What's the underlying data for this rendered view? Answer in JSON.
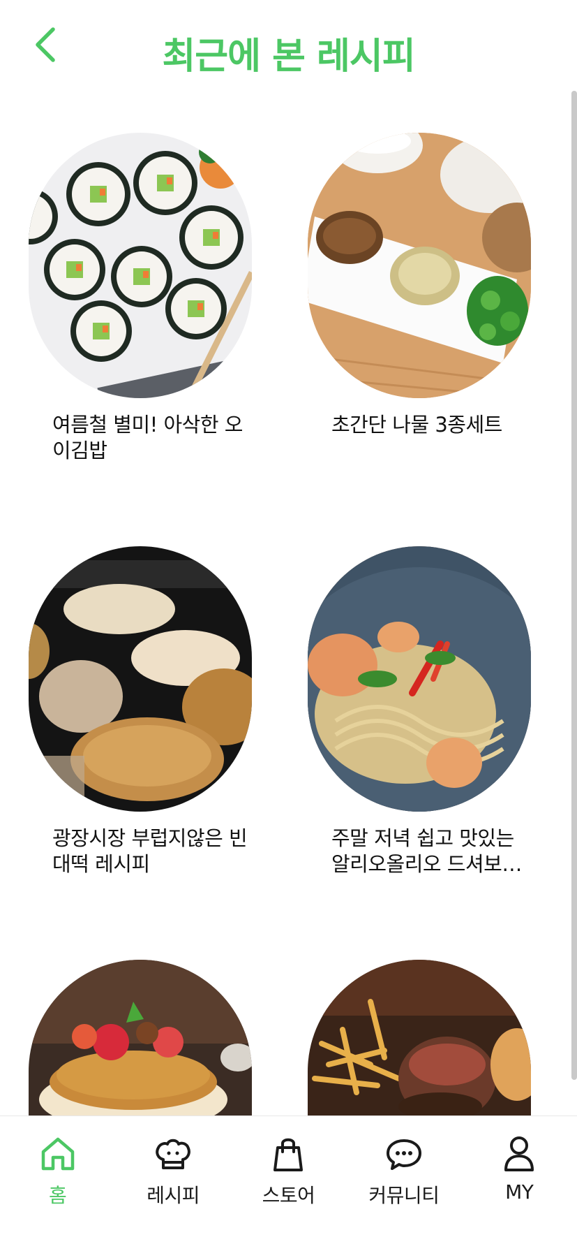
{
  "header": {
    "title": "최근에 본 레시피",
    "back_icon": "chevron-left-icon"
  },
  "colors": {
    "accent": "#4cc764",
    "text": "#111111"
  },
  "recipes": [
    {
      "title": "여름철 별미! 아삭한 오이김밥",
      "image": "cucumber-kimbap-photo"
    },
    {
      "title": "초간단 나물 3종세트",
      "image": "namul-side-dishes-photo"
    },
    {
      "title": "광장시장 부럽지않은 빈대떡 레시피",
      "image": "bindaetteok-pancake-photo"
    },
    {
      "title": "주말 저녁 쉽고 맛있는 알리오올리오 드셔보세요",
      "image": "shrimp-aglio-olio-photo"
    },
    {
      "title": "",
      "image": "fruit-pancake-stack-photo"
    },
    {
      "title": "",
      "image": "burger-fries-photo"
    }
  ],
  "nav": {
    "items": [
      {
        "label": "홈",
        "icon": "home-icon",
        "active": true
      },
      {
        "label": "레시피",
        "icon": "chef-hat-icon",
        "active": false
      },
      {
        "label": "스토어",
        "icon": "shopping-bag-icon",
        "active": false
      },
      {
        "label": "커뮤니티",
        "icon": "chat-bubble-icon",
        "active": false
      },
      {
        "label": "MY",
        "icon": "user-icon",
        "active": false
      }
    ]
  }
}
